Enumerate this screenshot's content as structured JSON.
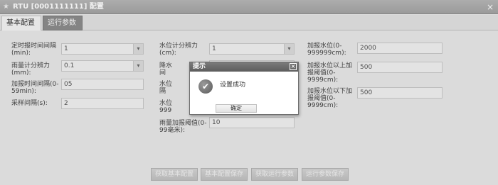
{
  "window": {
    "title": "RTU [0001111111] 配置",
    "close_glyph": "×"
  },
  "tabs": [
    {
      "label": "基本配置"
    },
    {
      "label": "运行参数"
    }
  ],
  "form": {
    "col1": [
      {
        "label": "定时报时间间隔\n(min):",
        "value": "1",
        "type": "select"
      },
      {
        "label": "雨量计分辨力\n(mm):",
        "value": "0.1",
        "type": "select"
      },
      {
        "label": "加报时间间隔(0-\n59min):",
        "value": "05",
        "type": "text"
      },
      {
        "label": "采样间隔(s):",
        "value": "2",
        "type": "text"
      }
    ],
    "col2": [
      {
        "label": "水位计分辨力\n(cm):",
        "value": "1",
        "type": "select"
      },
      {
        "label": "降水\n间",
        "value": "",
        "type": "text"
      },
      {
        "label": "水位\n隔",
        "value": "",
        "type": "text"
      },
      {
        "label": "水位\n999",
        "value": "",
        "type": "text"
      },
      {
        "label": "雨量加报阈值(0-\n99毫米):",
        "value": "10",
        "type": "text"
      }
    ],
    "col3": [
      {
        "label": "加报水位(0-\n999999cm):",
        "value": "2000"
      },
      {
        "label": "加报水位以上加\n报阈值(0-\n9999cm):",
        "value": "500"
      },
      {
        "label": "加报水位以下加\n报阈值(0-\n9999cm):",
        "value": "500"
      }
    ]
  },
  "buttons": {
    "get_basic": "获取基本配置",
    "save_basic": "基本配置保存",
    "get_run": "获取运行参数",
    "save_run": "运行参数保存"
  },
  "dialog": {
    "title": "提示",
    "message": "设置成功",
    "ok_label": "确定",
    "close_glyph": "×",
    "icon_glyph": "✔"
  }
}
